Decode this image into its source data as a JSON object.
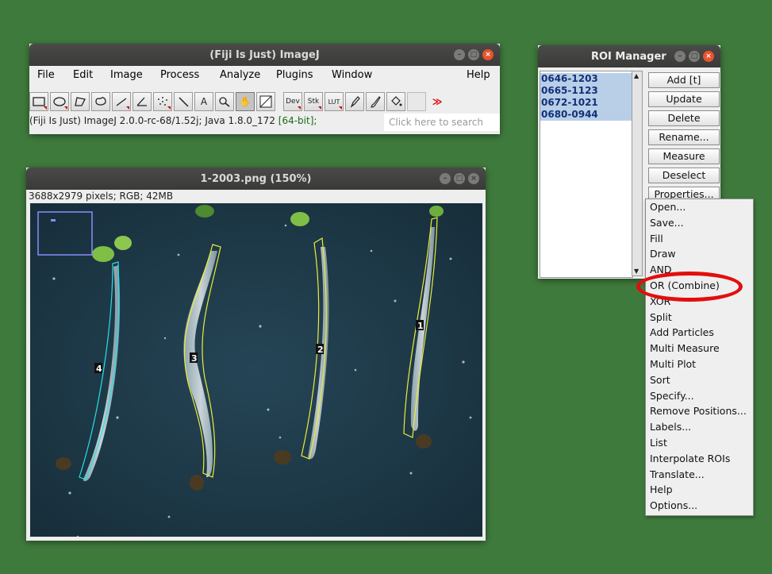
{
  "imagej": {
    "title": "(Fiji Is Just) ImageJ",
    "menus": [
      "File",
      "Edit",
      "Image",
      "Process",
      "Analyze",
      "Plugins",
      "Window",
      "Help"
    ],
    "tools": [
      "rectangle",
      "oval",
      "polygon",
      "freehand",
      "line",
      "angle",
      "multipoint",
      "wand",
      "text",
      "zoom",
      "hand",
      "color-picker",
      "Dev",
      "Stk",
      "LUT",
      "pencil",
      "brush",
      "flood-fill",
      "more"
    ],
    "status_text": "(Fiji Is Just) ImageJ 2.0.0-rc-68/1.52j; Java 1.8.0_172 ",
    "status_bits": "[64-bit];",
    "search_placeholder": "Click here to search"
  },
  "image_window": {
    "title": "1-2003.png (150%)",
    "info": "3688x2979 pixels; RGB; 42MB",
    "roi_labels": [
      "1",
      "2",
      "3",
      "4"
    ]
  },
  "roi_manager": {
    "title": "ROI Manager",
    "rois": [
      "0646-1203",
      "0665-1123",
      "0672-1021",
      "0680-0944"
    ],
    "buttons": [
      "Add [t]",
      "Update",
      "Delete",
      "Rename...",
      "Measure",
      "Deselect",
      "Properties..."
    ]
  },
  "more_menu": {
    "items": [
      "Open...",
      "Save...",
      "Fill",
      "Draw",
      "AND",
      "OR (Combine)",
      "XOR",
      "Split",
      "Add Particles",
      "Multi Measure",
      "Multi Plot",
      "Sort",
      "Specify...",
      "Remove Positions...",
      "Labels...",
      "List",
      "Interpolate ROIs",
      "Translate...",
      "Help",
      "Options..."
    ],
    "highlighted": "OR (Combine)",
    "highlight_color": "#e20e0e"
  }
}
